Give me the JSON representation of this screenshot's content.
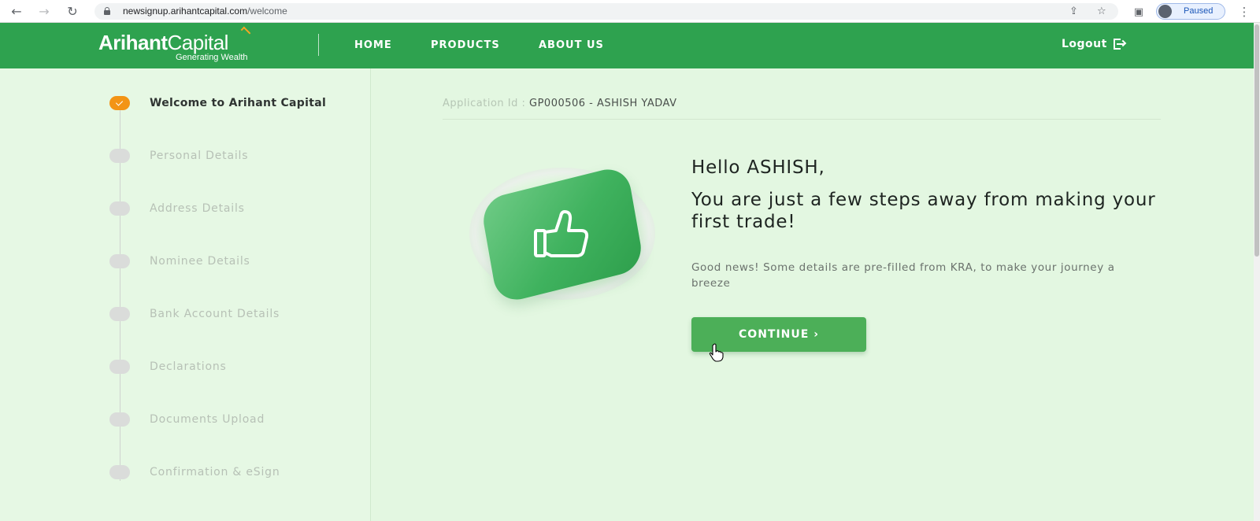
{
  "browser": {
    "url_host": "newsignup.arihantcapital.com",
    "url_path": "/welcome",
    "profile_status": "Paused",
    "icons": [
      "back-icon",
      "forward-icon",
      "reload-icon",
      "lock-icon",
      "share-icon",
      "bookmark-star-icon",
      "side-panel-icon",
      "avatar",
      "kebab-menu-icon"
    ]
  },
  "header": {
    "logo_bold": "Arihant",
    "logo_light": "Capital",
    "logo_tagline": "Generating Wealth",
    "nav": [
      "HOME",
      "PRODUCTS",
      "ABOUT US"
    ],
    "logout_label": "Logout",
    "brand_color": "#2ea24f"
  },
  "sidebar": {
    "steps": [
      {
        "label": "Welcome to Arihant Capital",
        "status": "completed"
      },
      {
        "label": "Personal Details",
        "status": "pending"
      },
      {
        "label": "Address Details",
        "status": "pending"
      },
      {
        "label": "Nominee Details",
        "status": "pending"
      },
      {
        "label": "Bank Account Details",
        "status": "pending"
      },
      {
        "label": "Declarations",
        "status": "pending"
      },
      {
        "label": "Documents Upload",
        "status": "pending"
      },
      {
        "label": "Confirmation & eSign",
        "status": "pending"
      }
    ]
  },
  "main": {
    "application_label": "Application Id :",
    "application_value": "GP000506 - ASHISH YADAV",
    "greeting": "Hello ASHISH,",
    "headline": "You are just a few steps away from making your first trade!",
    "subtext": "Good news! Some details are pre-filled from KRA, to make your journey a breeze",
    "continue_label": "CONTINUE ›",
    "illustration_icon": "thumbs-up-icon"
  }
}
